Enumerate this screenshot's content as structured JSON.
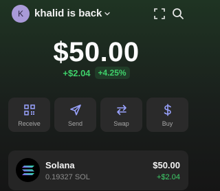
{
  "header": {
    "avatar_initial": "K",
    "account_name": "khalid is back"
  },
  "balance": {
    "total": "$50.00",
    "change_amount": "+$2.04",
    "change_percent": "+4.25%"
  },
  "actions": [
    {
      "label": "Receive",
      "icon": "qr-code-icon"
    },
    {
      "label": "Send",
      "icon": "send-icon"
    },
    {
      "label": "Swap",
      "icon": "swap-icon"
    },
    {
      "label": "Buy",
      "icon": "dollar-icon"
    }
  ],
  "tokens": [
    {
      "name": "Solana",
      "amount": "0.19327 SOL",
      "value": "$50.00",
      "change": "+$2.04",
      "icon": "solana-logo"
    }
  ],
  "colors": {
    "accent_green": "#3fd06a",
    "avatar_bg": "#a99ad8",
    "card_bg": "#2a2a2a"
  }
}
